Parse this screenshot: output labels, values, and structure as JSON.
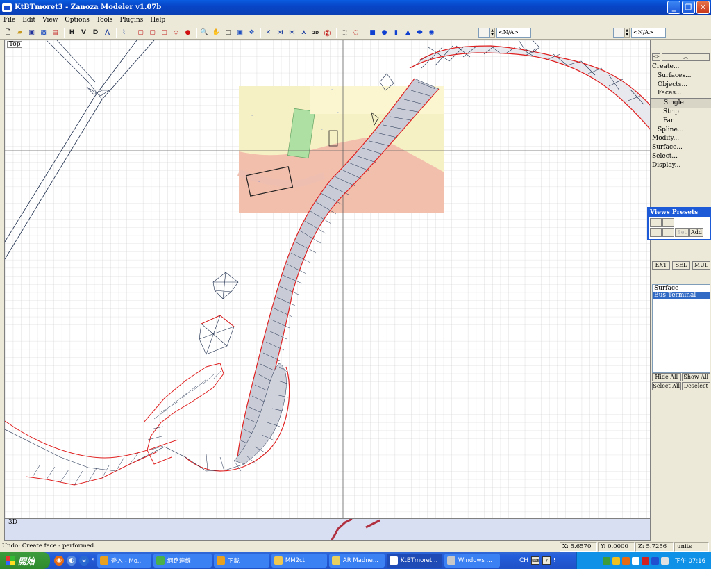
{
  "window": {
    "title": "KtBTmoret3 - Zanoza Modeler v1.07b",
    "buttons": [
      "_",
      "❐",
      "✕"
    ]
  },
  "menu": [
    "File",
    "Edit",
    "View",
    "Options",
    "Tools",
    "Plugins",
    "Help"
  ],
  "toolbar": {
    "view_letters": [
      "H",
      "V",
      "D"
    ],
    "spin_value_left": "",
    "na_left": "<N/A>",
    "na_right": "<N/A>"
  },
  "viewport": {
    "top_label": "Top",
    "bottom_label": "3D"
  },
  "right_panel": {
    "collapse_small": "<>",
    "collapse_wide": "︽",
    "tree": [
      {
        "label": "Create...",
        "level": 0
      },
      {
        "label": "Surfaces...",
        "level": 1
      },
      {
        "label": "Objects...",
        "level": 1
      },
      {
        "label": "Faces...",
        "level": 1
      },
      {
        "label": "Single",
        "level": 2,
        "selected": true
      },
      {
        "label": "Strip",
        "level": 2
      },
      {
        "label": "Fan",
        "level": 2
      },
      {
        "label": "Spline...",
        "level": 1
      },
      {
        "label": "Modify...",
        "level": 0
      },
      {
        "label": "Surface...",
        "level": 0
      },
      {
        "label": "Select...",
        "level": 0
      },
      {
        "label": "Display...",
        "level": 0
      }
    ],
    "presets": {
      "title": "Views Presets",
      "set_label": "Set",
      "add_label": "Add"
    },
    "modes": [
      "EXT",
      "SEL",
      "MUL"
    ],
    "list": [
      {
        "label": "Surface",
        "selected": false
      },
      {
        "label": "Bus Terminal",
        "selected": true
      }
    ],
    "list_buttons": [
      "Hide All",
      "Show All",
      "Select All",
      "Deselect"
    ]
  },
  "status": {
    "message": "Undo: Create face - performed.",
    "x": "X: 5.6570",
    "y": "Y: 0.0000",
    "z": "Z: 5.7256",
    "units": "units"
  },
  "taskbar": {
    "start": "開始",
    "tasks": [
      {
        "label": "登入 - Mo...",
        "color": "#e8a020"
      },
      {
        "label": "網路連線",
        "color": "#4ab04a"
      },
      {
        "label": "下載",
        "color": "#e8a020"
      },
      {
        "label": "MM2ct",
        "color": "#f0c850"
      },
      {
        "label": "AR Madne...",
        "color": "#e8d060"
      },
      {
        "label": "KtBTmoret...",
        "color": "#2050d0",
        "active": true
      },
      {
        "label": "Windows ...",
        "color": "#c8c8c8"
      }
    ],
    "lang": "CH",
    "clock": "下午 07:16"
  },
  "colors": {
    "titlebar": "#0a4fd0",
    "mesh_edge": "#1a2a4a",
    "mesh_boundary": "#e02020",
    "selection_blue": "#316ac5"
  }
}
